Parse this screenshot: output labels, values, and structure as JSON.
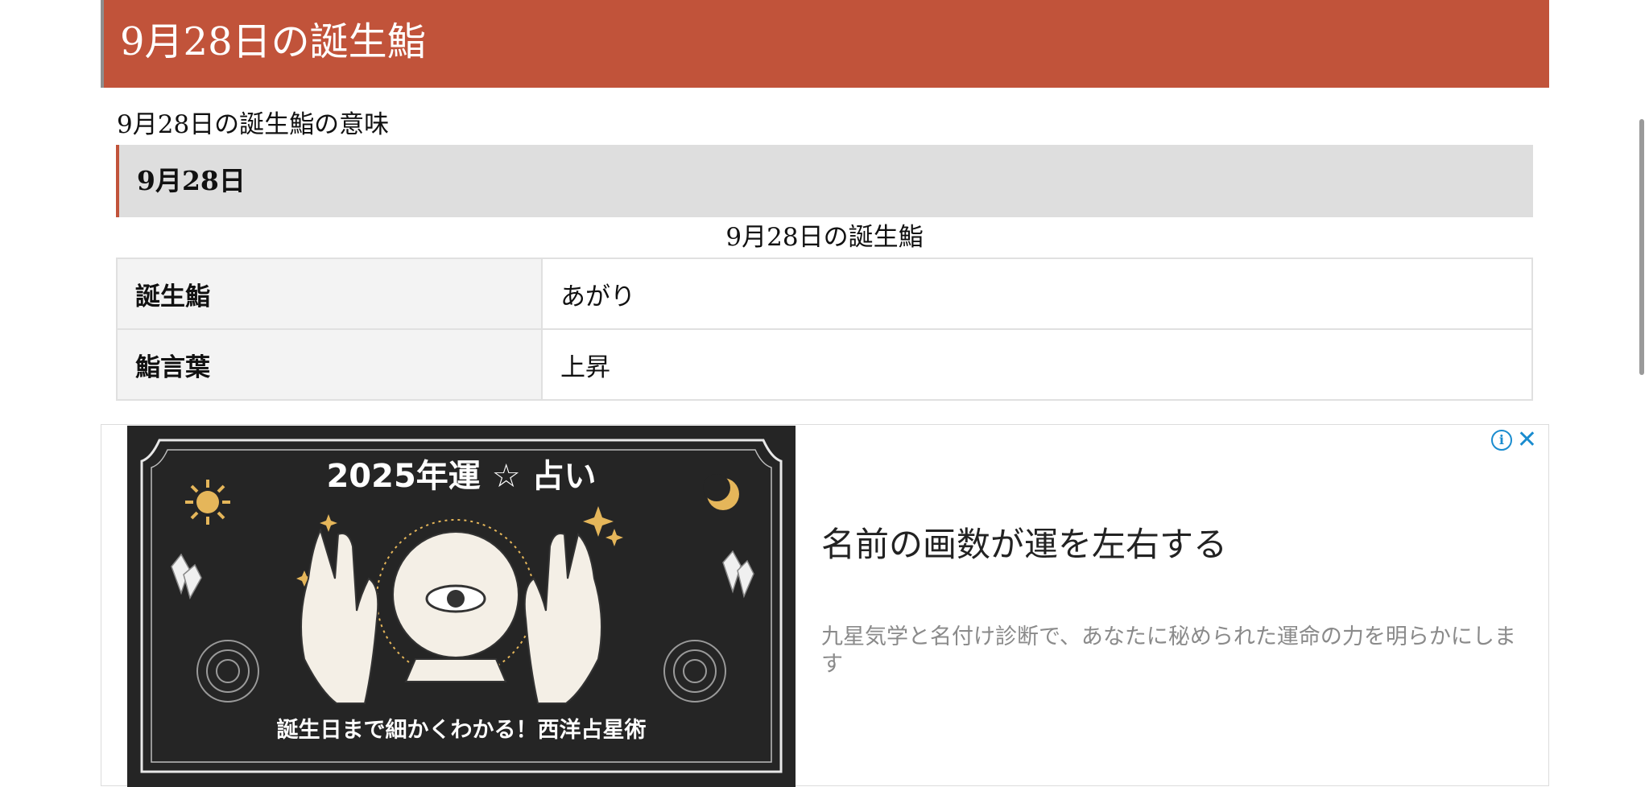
{
  "header": {
    "title": "9月28日の誕生鮨"
  },
  "section": {
    "subtitle": "9月28日の誕生鮨の意味"
  },
  "date_heading": {
    "label": "9月28日"
  },
  "table": {
    "caption": "9月28日の誕生鮨",
    "rows": [
      {
        "key": "誕生鮨",
        "value": "あがり"
      },
      {
        "key": "鮨言葉",
        "value": "上昇"
      }
    ]
  },
  "ad": {
    "banner_title": "2025年運 ☆ 占い",
    "banner_subtitle": "誕生日まで細かくわかる！西洋占星術",
    "headline": "名前の画数が運を左右する",
    "description": "九星気学と名付け診断で、あなたに秘められた運命の力を明らかにします",
    "info_glyph": "i",
    "close_glyph": "✕"
  },
  "colors": {
    "header_bg": "#c1533a",
    "accent": "#c1533a",
    "heading_bg": "#dedede",
    "ad_control": "#1a8ccf",
    "ad_image_bg": "#252525"
  }
}
